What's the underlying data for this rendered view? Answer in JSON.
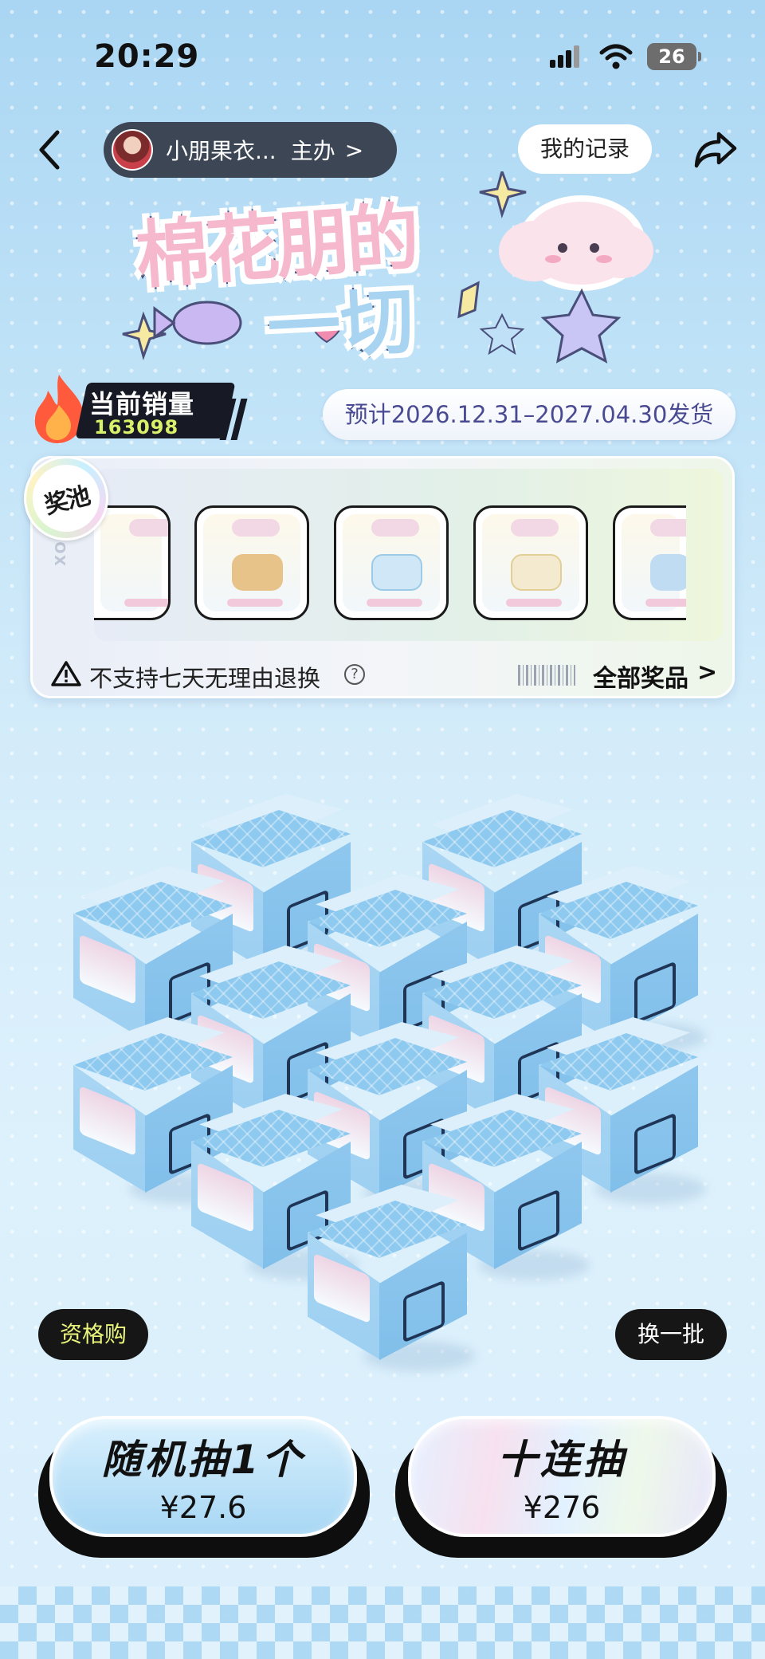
{
  "status_bar": {
    "time": "20:29",
    "battery": "26"
  },
  "header": {
    "store_name": "小朋果衣...",
    "store_role": "主办",
    "store_chevron": ">",
    "record_button": "我的记录"
  },
  "sales": {
    "label": "当前销量",
    "count": "163098"
  },
  "shipping": {
    "text": "预计2026.12.31–2027.04.30发货"
  },
  "prize_pool": {
    "badge": "奖池",
    "rail_text": "XOAAA",
    "prizes": [
      {
        "item": "partial",
        "color": "#f3e4c8"
      },
      {
        "item": "bear-set",
        "color": "#e7c38a"
      },
      {
        "item": "clear-case",
        "color": "#cfe7f6"
      },
      {
        "item": "gold-case",
        "color": "#eadcb4"
      },
      {
        "item": "blue-set",
        "color": "#bfdcf2"
      }
    ],
    "warning": "不支持七天无理由退换",
    "help": "?",
    "all_prizes": "全部奖品",
    "all_prizes_chevron": ">"
  },
  "actions": {
    "qualification_buy": "资格购",
    "swap_batch": "换一批",
    "single_draw": {
      "title": "随机抽1个",
      "price": "¥27.6"
    },
    "ten_draw": {
      "title": "十连抽",
      "price": "¥276"
    }
  },
  "colors": {
    "accent_dark": "#161616",
    "qualify_text": "#e9f47a",
    "ship_text": "#4a4a92",
    "sales_count": "#d9f06a"
  }
}
